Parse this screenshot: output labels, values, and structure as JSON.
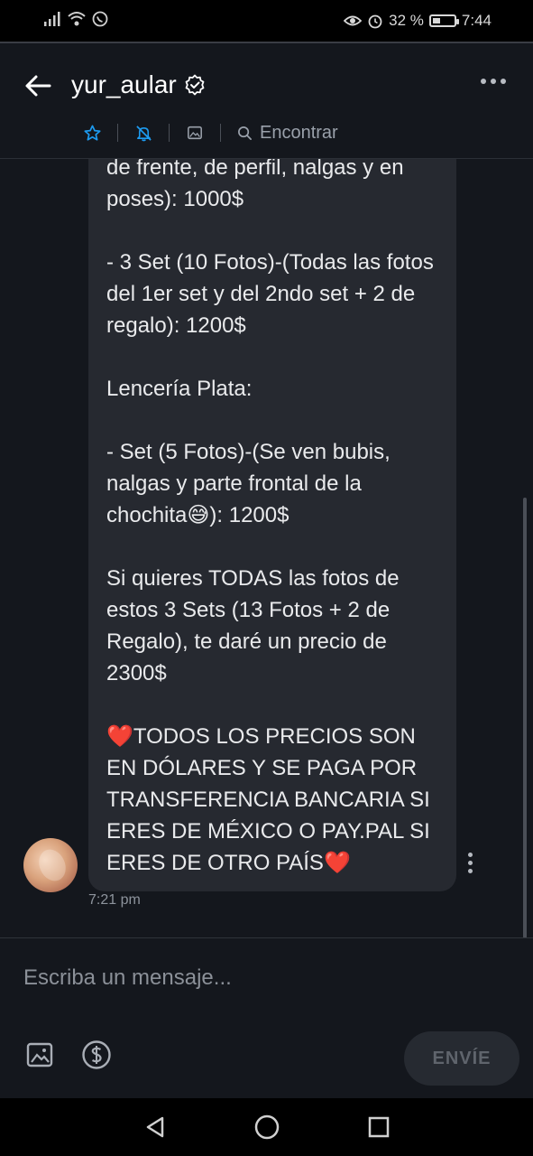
{
  "status_bar": {
    "battery": "32 %",
    "time": "7:44"
  },
  "header": {
    "title": "yur_aular",
    "search_label": "Encontrar"
  },
  "message": {
    "text_top": "de frente, de perfil, nalgas y en poses): 1000$\n\n- 3 Set (10 Fotos)-(Todas las fotos del 1er set y del 2ndo set + 2 de regalo): 1200$\n\nLencería Plata:\n\n- Set (5 Fotos)-(Se ven bubis, nalgas y parte frontal de la chochita😅): 1200$\n\nSi quieres TODAS las fotos de estos 3 Sets (13 Fotos + 2 de Regalo), te daré un precio de 2300$\n\n❤️TODOS LOS PRECIOS SON EN DÓLARES Y SE PAGA POR TRANSFERENCIA BANCARIA SI ERES DE MÉXICO O PAY.PAL SI ERES DE OTRO PAÍS❤️",
    "time": "7:21 pm"
  },
  "composer": {
    "placeholder": "Escriba un mensaje...",
    "send_label": "ENVÍE"
  },
  "colors": {
    "background": "#14171d",
    "bubble": "#262930",
    "accent": "#1d9bf0",
    "heart": "#e0283a"
  },
  "icons": {
    "back": "arrow-left-icon",
    "verified": "verified-badge-icon",
    "more": "more-horizontal-icon",
    "star": "star-icon",
    "mute": "bell-off-icon",
    "media": "image-icon",
    "search": "search-icon",
    "image_attach": "image-icon",
    "tip": "dollar-icon"
  }
}
